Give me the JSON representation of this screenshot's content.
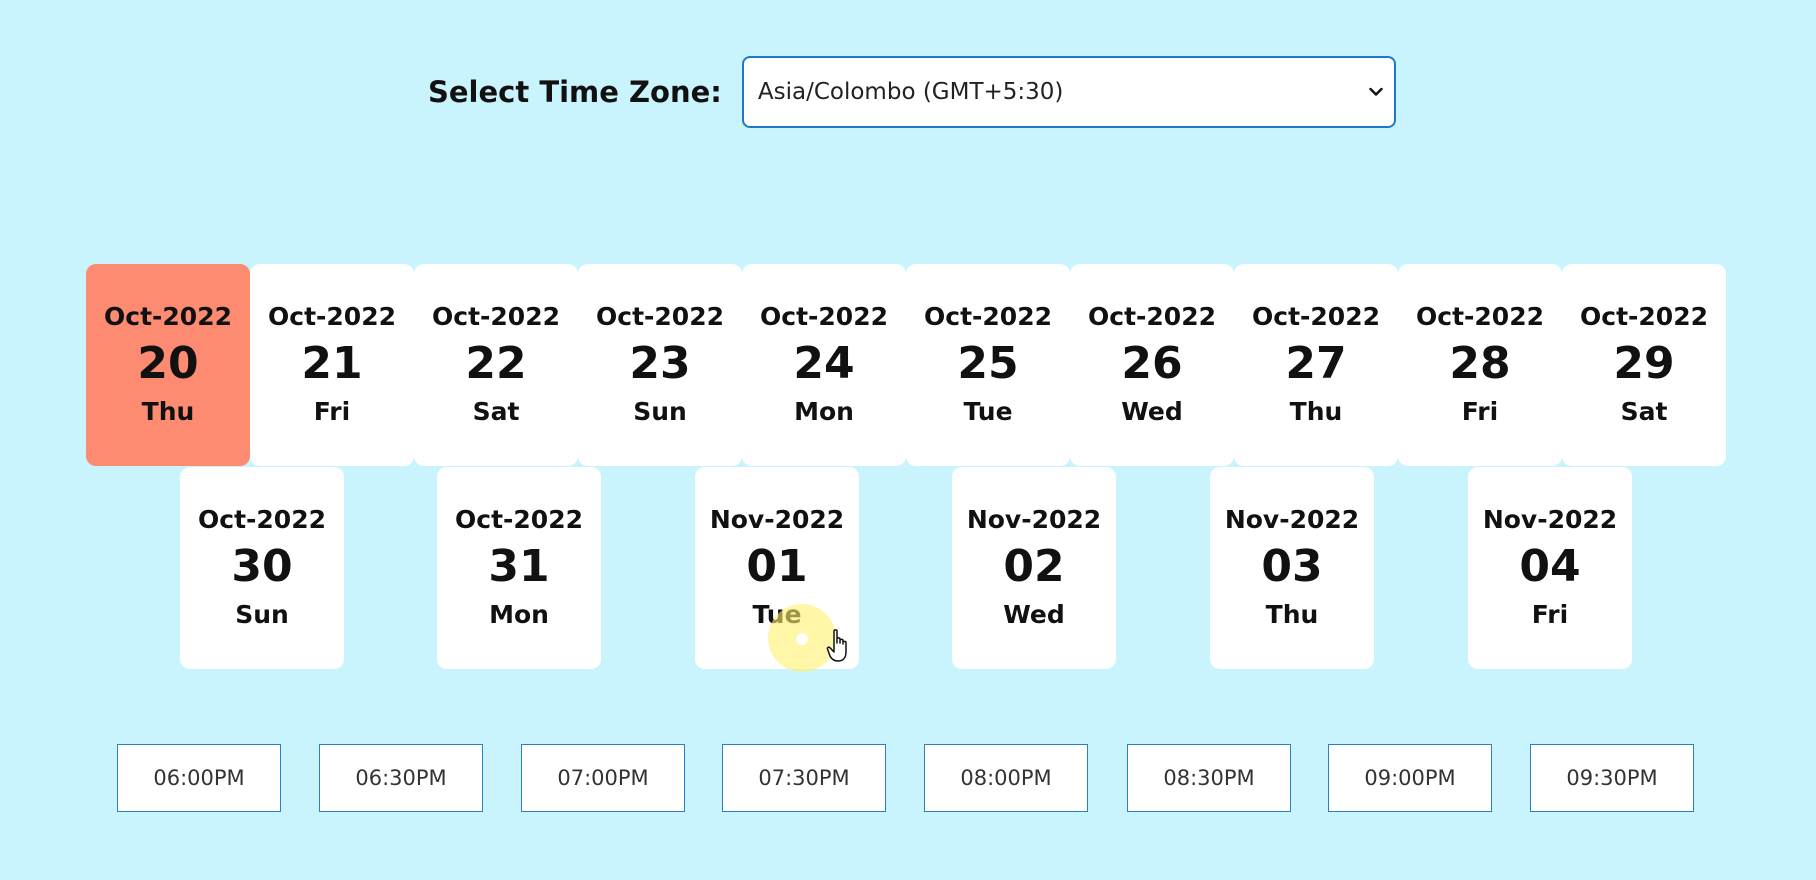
{
  "timezone": {
    "label": "Select Time Zone:",
    "selected": "Asia/Colombo (GMT+5:30)",
    "icon": "chevron-down-icon"
  },
  "colors": {
    "background": "#c9f4fd",
    "selected_card": "#fc8b72",
    "card": "#ffffff",
    "slot_border": "#2c7fc4"
  },
  "dates": [
    {
      "month": "Oct-2022",
      "day": "20",
      "weekday": "Thu",
      "selected": true
    },
    {
      "month": "Oct-2022",
      "day": "21",
      "weekday": "Fri"
    },
    {
      "month": "Oct-2022",
      "day": "22",
      "weekday": "Sat"
    },
    {
      "month": "Oct-2022",
      "day": "23",
      "weekday": "Sun"
    },
    {
      "month": "Oct-2022",
      "day": "24",
      "weekday": "Mon"
    },
    {
      "month": "Oct-2022",
      "day": "25",
      "weekday": "Tue"
    },
    {
      "month": "Oct-2022",
      "day": "26",
      "weekday": "Wed"
    },
    {
      "month": "Oct-2022",
      "day": "27",
      "weekday": "Thu"
    },
    {
      "month": "Oct-2022",
      "day": "28",
      "weekday": "Fri"
    },
    {
      "month": "Oct-2022",
      "day": "29",
      "weekday": "Sat"
    },
    {
      "month": "Oct-2022",
      "day": "30",
      "weekday": "Sun"
    },
    {
      "month": "Oct-2022",
      "day": "31",
      "weekday": "Mon"
    },
    {
      "month": "Nov-2022",
      "day": "01",
      "weekday": "Tue"
    },
    {
      "month": "Nov-2022",
      "day": "02",
      "weekday": "Wed"
    },
    {
      "month": "Nov-2022",
      "day": "03",
      "weekday": "Thu"
    },
    {
      "month": "Nov-2022",
      "day": "04",
      "weekday": "Fri"
    }
  ],
  "time_slots": [
    "06:00PM",
    "06:30PM",
    "07:00PM",
    "07:30PM",
    "08:00PM",
    "08:30PM",
    "09:00PM",
    "09:30PM"
  ]
}
